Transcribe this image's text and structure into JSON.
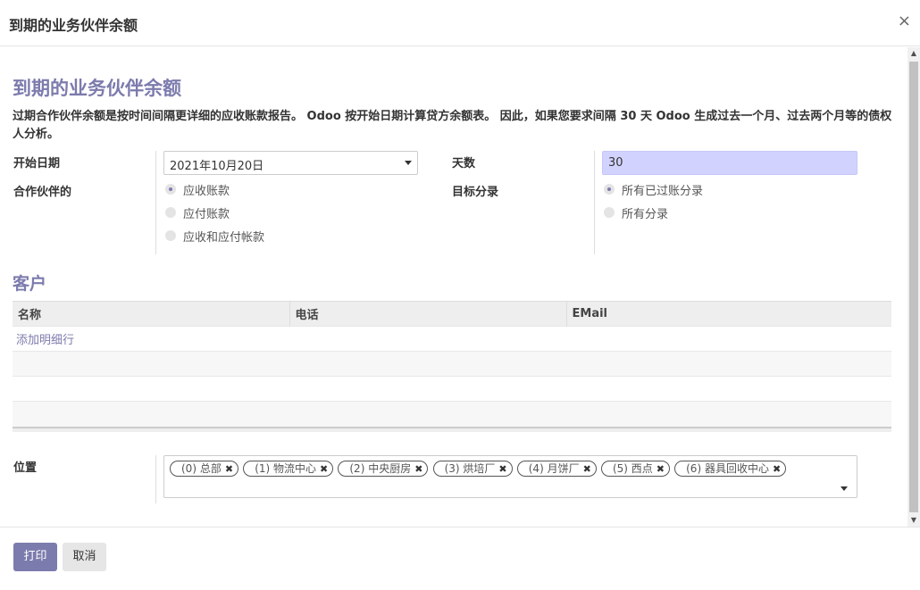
{
  "dialog": {
    "title": "到期的业务伙伴余额",
    "close_glyph": "×"
  },
  "form": {
    "heading": "到期的业务伙伴余额",
    "description": "过期合作伙伴余额是按时间间隔更详细的应收账款报告。 Odoo 按开始日期计算贷方余额表。 因此，如果您要求间隔 30 天 Odoo 生成过去一个月、过去两个月等的债权人分析。",
    "start_date": {
      "label": "开始日期",
      "value": "2021年10月20日"
    },
    "days": {
      "label": "天数",
      "value": "30"
    },
    "partner_type": {
      "label": "合作伙伴的",
      "options": [
        {
          "label": "应收账款",
          "checked": true
        },
        {
          "label": "应付账款",
          "checked": false
        },
        {
          "label": "应收和应付帐款",
          "checked": false
        }
      ]
    },
    "target_move": {
      "label": "目标分录",
      "options": [
        {
          "label": "所有已过账分录",
          "checked": true
        },
        {
          "label": "所有分录",
          "checked": false
        }
      ]
    }
  },
  "customers": {
    "heading": "客户",
    "columns": [
      "名称",
      "电话",
      "EMail"
    ],
    "add_line": "添加明细行"
  },
  "location": {
    "label": "位置",
    "tags": [
      "(0) 总部",
      "(1) 物流中心",
      "(2) 中央厨房",
      "(3) 烘培厂",
      "(4) 月饼厂",
      "(5) 西点",
      "(6) 器具回收中心"
    ],
    "tag_remove_glyph": "✖"
  },
  "footer": {
    "print_label": "打印",
    "cancel_label": "取消"
  },
  "colors": {
    "accent": "#7c7bad",
    "days_input_bg": "#d2d2ff"
  }
}
